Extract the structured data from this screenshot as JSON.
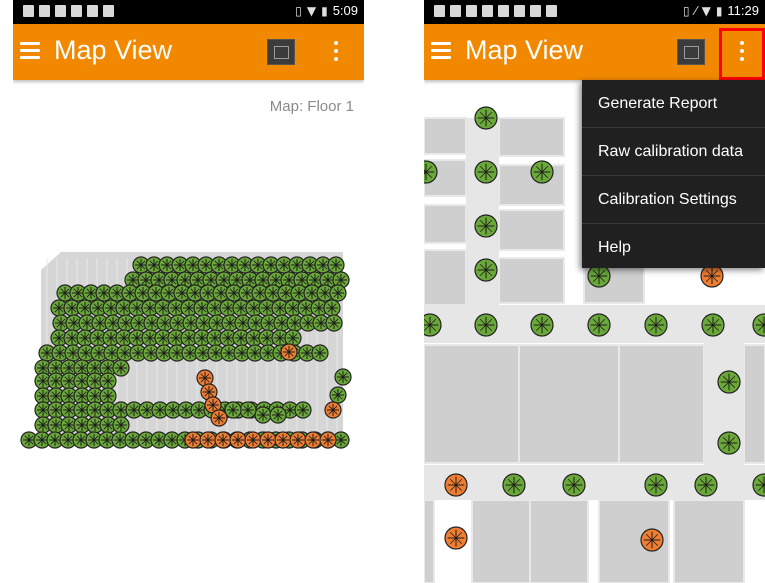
{
  "colors": {
    "app_bar": "#f28800",
    "tracked_point": "#6aa83a",
    "flagged_point": "#ef7d32",
    "menu_background": "#202020",
    "highlight": "#ff0000"
  },
  "left_screen": {
    "status_bar": {
      "time": "5:09"
    },
    "app_bar": {
      "title": "Map View",
      "menu_icon": "hamburger-icon",
      "map_icon": "map-icon",
      "overflow_icon": "more-vert-icon"
    },
    "map_label": "Map: Floor 1"
  },
  "right_screen": {
    "status_bar": {
      "time": "11:29"
    },
    "app_bar": {
      "title": "Map View",
      "menu_icon": "hamburger-icon",
      "map_icon": "map-icon",
      "overflow_icon": "more-vert-icon"
    },
    "overflow_menu": {
      "items": [
        {
          "label": "Generate Report"
        },
        {
          "label": "Raw calibration data"
        },
        {
          "label": "Calibration Settings"
        },
        {
          "label": "Help"
        }
      ]
    }
  }
}
